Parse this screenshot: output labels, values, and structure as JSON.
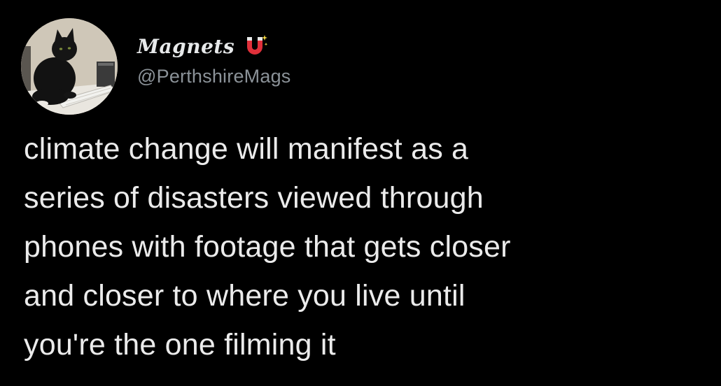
{
  "author": {
    "display_name": "Magnets",
    "handle": "@PerthshireMags",
    "name_emoji_icon": "magnet-icon",
    "avatar_icon": "black-cat-avatar"
  },
  "tweet": {
    "lines": [
      "climate change will manifest as a",
      "series of disasters viewed through",
      "phones with footage that gets closer",
      "and closer to where you live until",
      "you're the one filming it"
    ]
  },
  "colors": {
    "background": "#000000",
    "text_primary": "#e7e9ea",
    "text_secondary": "#8b9298",
    "magnet_red": "#e0303a"
  }
}
